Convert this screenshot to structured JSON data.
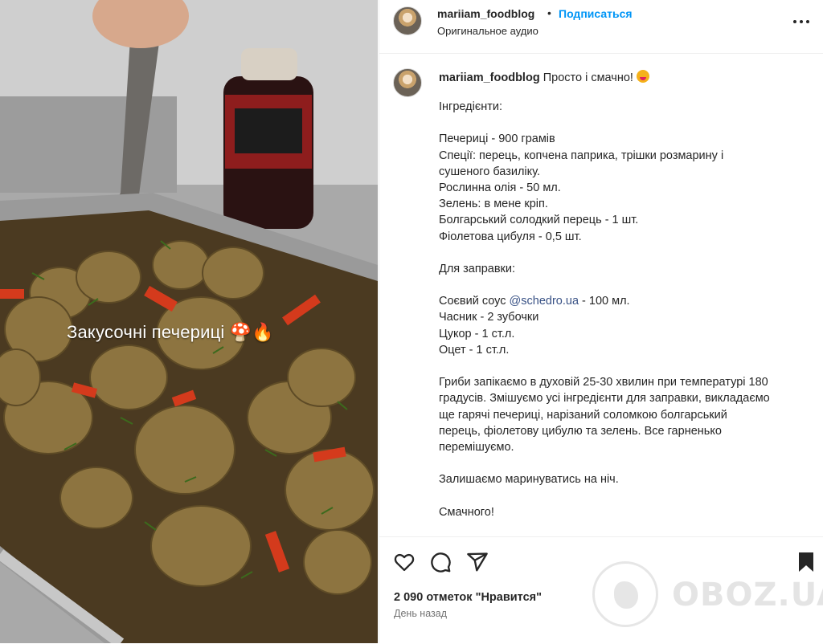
{
  "post": {
    "username": "mariiam_foodblog",
    "separator": "•",
    "follow_label": "Подписаться",
    "audio_label": "Оригинальное аудио"
  },
  "media": {
    "overlay_text": "Закусочні печериці 🍄🔥"
  },
  "caption": {
    "username": "mariiam_foodblog",
    "intro": " Просто і смачно!",
    "lines": [
      "Інгредієнти:",
      "",
      "Печериці - 900 грамів",
      "Спеції: перець, копчена паприка, трішки розмарину і",
      "сушеного базиліку.",
      "Рослинна олія - 50 мл.",
      "Зелень: в мене кріп.",
      "Болгарський солодкий перець - 1 шт.",
      "Фіолетова цибуля - 0,5 шт.",
      "",
      "Для заправки:",
      "",
      "SOY_LINE",
      "Часник - 2 зубочки",
      "Цукор - 1 ст.л.",
      "Оцет - 1 ст.л.",
      "",
      "Гриби запікаємо в духовій 25-30 хвилин при температурі 180",
      "градусів. Змішуємо усі інгредієнти для заправки, викладаємо",
      "ще гарячі печериці, нарізаний соломкою болгарський",
      "перець, фіолетову цибулю та зелень. Все гарненько",
      "перемішуємо.",
      "",
      "Залишаємо маринуватись на ніч.",
      "",
      "Смачного!"
    ],
    "soy_line": {
      "before": "Соєвий соус ",
      "mention": "@schedro.ua",
      "after": " - 100 мл."
    }
  },
  "footer": {
    "likes": "2 090 отметок \"Нравится\"",
    "time_ago": "День назад"
  },
  "watermark": {
    "text": "OBOZ.UA"
  },
  "colors": {
    "link": "#0095f6",
    "mention": "#385185",
    "text": "#262626",
    "muted": "#737373"
  },
  "icons": [
    "more-options-icon",
    "heart-icon",
    "comment-icon",
    "share-icon",
    "bookmark-icon",
    "oboz-logo-icon"
  ]
}
